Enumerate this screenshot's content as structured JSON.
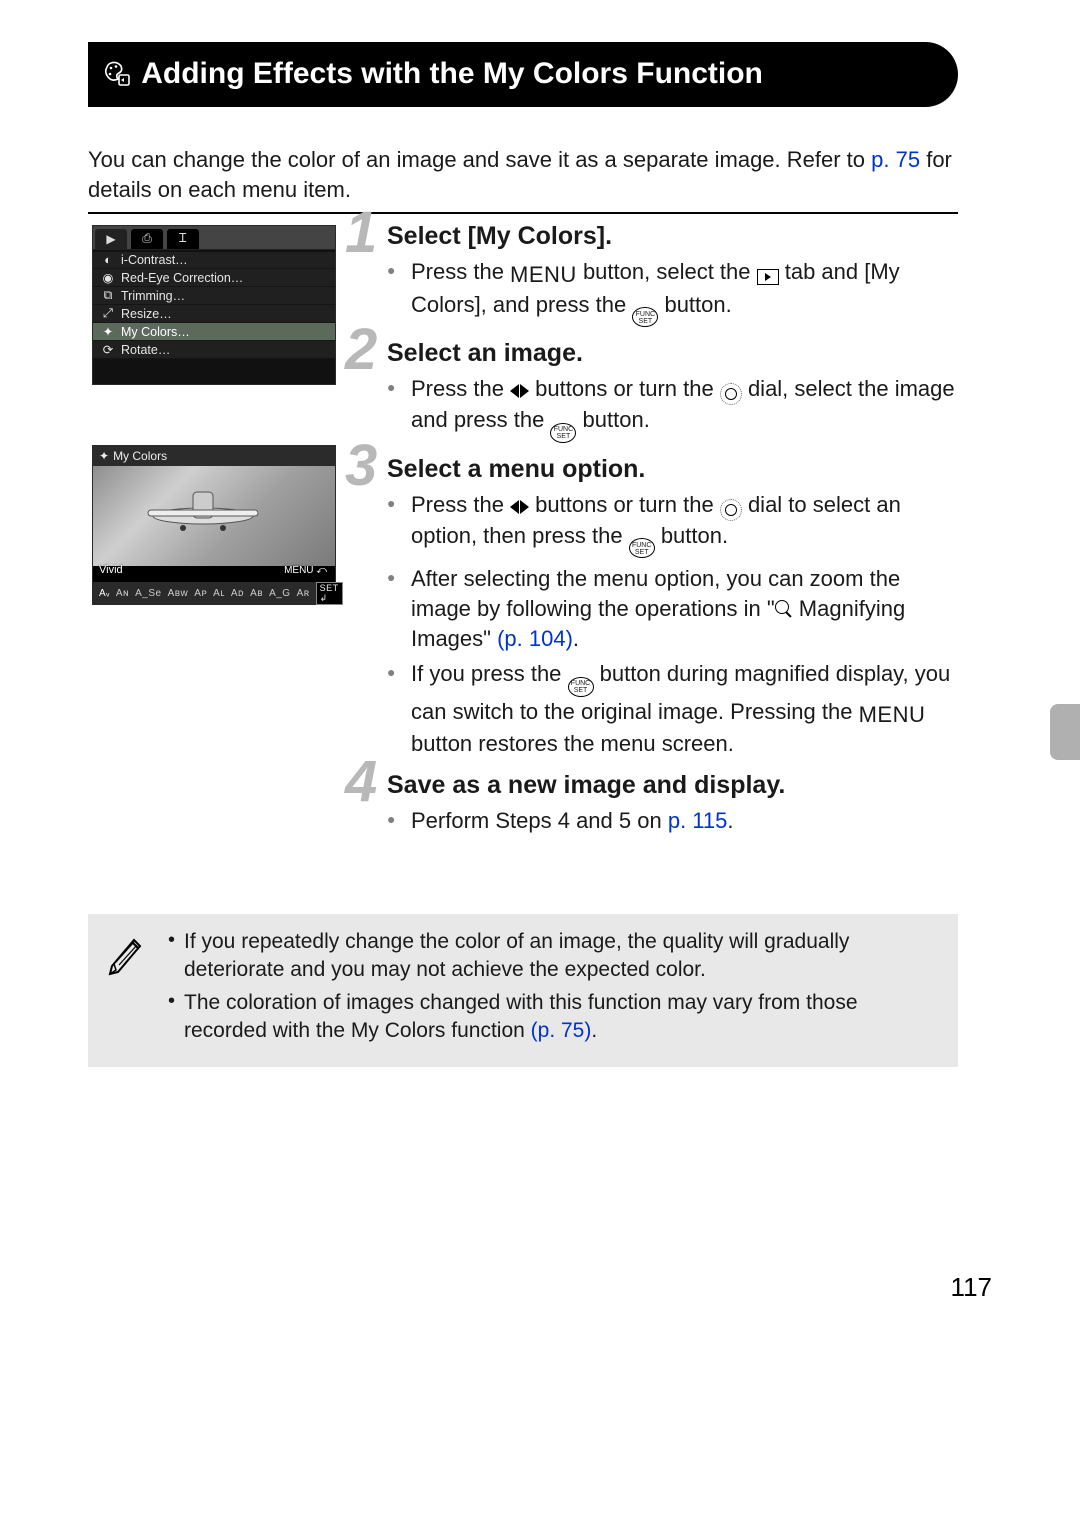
{
  "page": {
    "title": "Adding Effects with the My Colors Function",
    "intro": {
      "line1": "You can change the color of an image and save it as a separate image. Refer to ",
      "link1": "p. 75",
      "line2": " for details on each menu item."
    },
    "page_number": "117"
  },
  "screenshot1": {
    "items": [
      "i-Contrast…",
      "Red-Eye Correction…",
      "Trimming…",
      "Resize…",
      "My Colors…",
      "Rotate…"
    ],
    "highlight_index": 4
  },
  "screenshot2": {
    "header": "My Colors",
    "current_label": "Vivid",
    "menu_label": "MENU ⤺",
    "options": [
      "Aᵥ",
      "Aɴ",
      "A_Se",
      "Aʙw",
      "Aᴘ",
      "Aʟ",
      "Aᴅ",
      "Aʙ",
      "A_G",
      "Aʀ"
    ],
    "set_label": "SET ↲"
  },
  "steps": [
    {
      "num": "1",
      "title": "Select [My Colors].",
      "bullets": [
        {
          "parts": [
            {
              "t": "text",
              "v": "Press the "
            },
            {
              "t": "menu"
            },
            {
              "t": "text",
              "v": " button, select the "
            },
            {
              "t": "play"
            },
            {
              "t": "text",
              "v": " tab and [My Colors], and press the "
            },
            {
              "t": "funcset"
            },
            {
              "t": "text",
              "v": " button."
            }
          ]
        }
      ]
    },
    {
      "num": "2",
      "title": "Select an image.",
      "bullets": [
        {
          "parts": [
            {
              "t": "text",
              "v": "Press the "
            },
            {
              "t": "lr"
            },
            {
              "t": "text",
              "v": " buttons or turn the "
            },
            {
              "t": "dial"
            },
            {
              "t": "text",
              "v": " dial, select the image and press the "
            },
            {
              "t": "funcset"
            },
            {
              "t": "text",
              "v": " button."
            }
          ]
        }
      ]
    },
    {
      "num": "3",
      "title": "Select a menu option.",
      "bullets": [
        {
          "parts": [
            {
              "t": "text",
              "v": "Press the "
            },
            {
              "t": "lr"
            },
            {
              "t": "text",
              "v": " buttons or turn the "
            },
            {
              "t": "dial"
            },
            {
              "t": "text",
              "v": " dial to select an option, then press the "
            },
            {
              "t": "funcset"
            },
            {
              "t": "text",
              "v": " button."
            }
          ]
        },
        {
          "parts": [
            {
              "t": "text",
              "v": "After selecting the menu option, you can zoom the image by following the operations in \""
            },
            {
              "t": "magnify"
            },
            {
              "t": "text",
              "v": " Magnifying Images\" "
            },
            {
              "t": "link",
              "v": "(p. 104)"
            },
            {
              "t": "text",
              "v": "."
            }
          ]
        },
        {
          "parts": [
            {
              "t": "text",
              "v": "If you press the "
            },
            {
              "t": "funcset"
            },
            {
              "t": "text",
              "v": " button during magnified display, you can switch to the original image. Pressing the "
            },
            {
              "t": "menu"
            },
            {
              "t": "text",
              "v": " button restores the menu screen."
            }
          ]
        }
      ]
    },
    {
      "num": "4",
      "title": "Save as a new image and display.",
      "bullets": [
        {
          "parts": [
            {
              "t": "text",
              "v": "Perform Steps 4 and 5 on "
            },
            {
              "t": "link",
              "v": "p. 115"
            },
            {
              "t": "text",
              "v": "."
            }
          ]
        }
      ]
    }
  ],
  "notes": [
    {
      "parts": [
        {
          "t": "text",
          "v": "If you repeatedly change the color of an image, the quality will gradually deteriorate and you may not achieve the expected color."
        }
      ]
    },
    {
      "parts": [
        {
          "t": "text",
          "v": "The coloration of images changed with this function may vary from those recorded with the My Colors function "
        },
        {
          "t": "link",
          "v": "(p. 75)"
        },
        {
          "t": "text",
          "v": "."
        }
      ]
    }
  ]
}
